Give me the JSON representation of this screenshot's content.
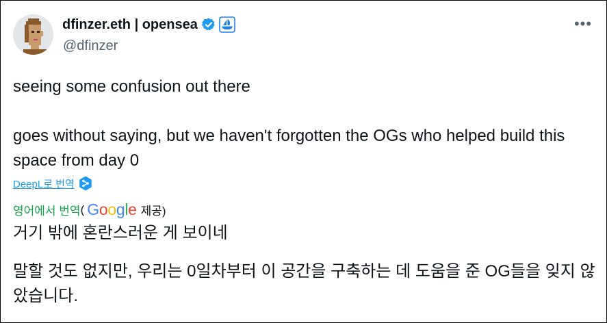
{
  "author": {
    "display_name": "dfinzer.eth | opensea",
    "handle": "@dfinzer",
    "avatar_icon": "pixel-punk-avatar",
    "verified_icon": "verified-badge-icon",
    "affiliate_icon": "opensea-logo-icon"
  },
  "more_button": {
    "label": "•••",
    "icon": "more-options-icon"
  },
  "tweet": {
    "paragraph_1": "seeing some confusion out there",
    "paragraph_2": "goes without saying, but we haven't forgotten the OGs who helped build this space from day 0"
  },
  "deepl": {
    "link_label": "DeepL로 번역",
    "icon": "deepl-icon"
  },
  "google_translate": {
    "label": "영어에서 번역",
    "paren_open": "(",
    "google_word": [
      "G",
      "o",
      "o",
      "g",
      "l",
      "e"
    ],
    "provided_by": "제공)"
  },
  "translation": {
    "paragraph_1": "거기 밖에 혼란스러운 게 보이네",
    "paragraph_2": "말할 것도 없지만, 우리는 0일차부터 이 공간을 구축하는 데 도움을 준 OG들을 잊지 않았습니다."
  },
  "colors": {
    "text": "#0f1419",
    "secondary": "#536471",
    "link": "#1d9bf0",
    "verified": "#1d9bf0",
    "google_translate_label": "#17a34a",
    "opensea": "#2081e2"
  }
}
